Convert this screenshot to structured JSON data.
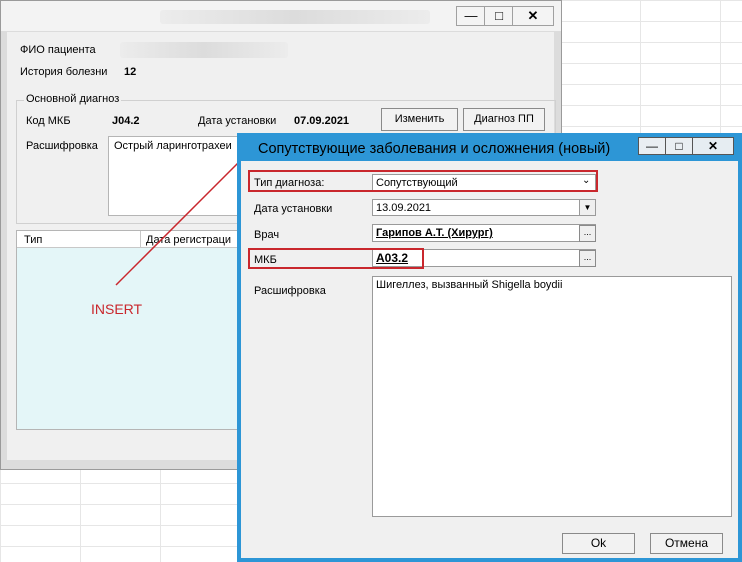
{
  "main_window": {
    "patient_label": "ФИО пациента",
    "history_label": "История болезни",
    "history_value": "12",
    "group_title": "Основной диагноз",
    "mkb_label": "Код МКБ",
    "mkb_value": "J04.2",
    "date_label": "Дата установки",
    "date_value": "07.09.2021",
    "change_button": "Изменить",
    "diag_pp_button": "Диагноз ПП",
    "decode_label": "Расшифровка",
    "decode_value": "Острый ларинготрахеи",
    "grid_col_type": "Тип",
    "grid_col_reg": "Дата регистраци"
  },
  "annotation": {
    "label": "INSERT",
    "color": "#c9272d"
  },
  "dialog": {
    "title": "Сопутствующие заболевания и осложнения (новый)",
    "type_label": "Тип диагноза:",
    "type_value": "Сопутствующий",
    "date_label": "Дата установки",
    "date_value": "13.09.2021",
    "doctor_label": "Врач",
    "doctor_value": "Гарипов А.Т. (Хирург)",
    "mkb_label": "МКБ",
    "mkb_value": "A03.2",
    "decode_label": "Расшифровка",
    "decode_value": "Шигеллез, вызванный Shigella boydii",
    "ok_button": "Ok",
    "cancel_button": "Отмена",
    "accent_color": "#2d96d6"
  },
  "icons": [
    "minimize-icon",
    "maximize-icon",
    "close-icon",
    "dropdown-arrow-icon",
    "ellipsis-icon"
  ]
}
